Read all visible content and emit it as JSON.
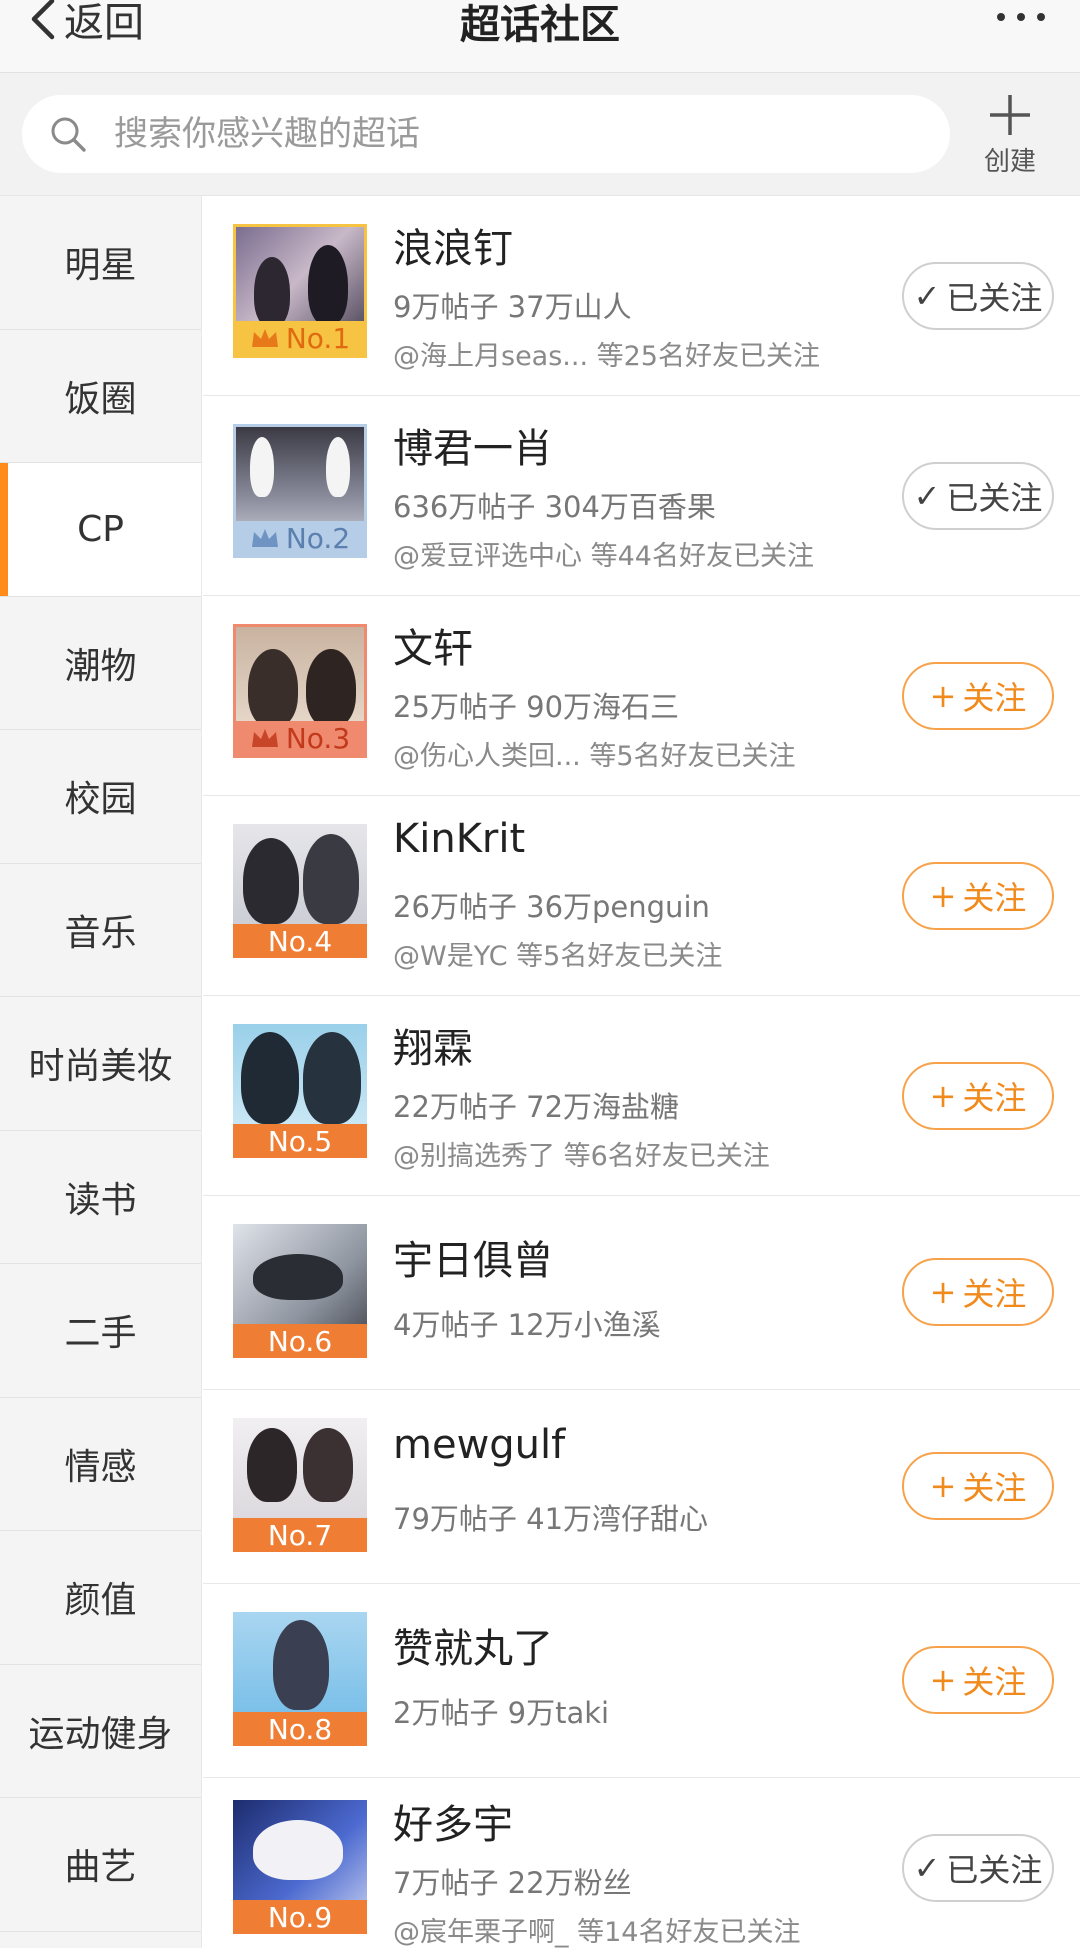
{
  "nav": {
    "back_label": "返回",
    "title": "超话社区"
  },
  "search": {
    "placeholder": "搜索你感兴趣的超话",
    "create_label": "创建"
  },
  "categories": [
    {
      "label": "明星"
    },
    {
      "label": "饭圈"
    },
    {
      "label": "CP"
    },
    {
      "label": "潮物"
    },
    {
      "label": "校园"
    },
    {
      "label": "音乐"
    },
    {
      "label": "时尚美妆"
    },
    {
      "label": "读书"
    },
    {
      "label": "二手"
    },
    {
      "label": "情感"
    },
    {
      "label": "颜值"
    },
    {
      "label": "运动健身"
    },
    {
      "label": "曲艺"
    }
  ],
  "active_category": "CP",
  "topics": [
    {
      "name": "浪浪钉",
      "stats": "9万帖子 37万山人",
      "friends": "@海上月seas... 等25名好友已关注",
      "rank": "No.1",
      "followed": true,
      "button": "已关注"
    },
    {
      "name": "博君一肖",
      "stats": "636万帖子 304万百香果",
      "friends": "@爱豆评选中心 等44名好友已关注",
      "rank": "No.2",
      "followed": true,
      "button": "已关注"
    },
    {
      "name": "文轩",
      "stats": "25万帖子 90万海石三",
      "friends": "@伤心人类回... 等5名好友已关注",
      "rank": "No.3",
      "followed": false,
      "button": "关注"
    },
    {
      "name": "KinKrit",
      "stats": "26万帖子 36万penguin",
      "friends": "@W是YC 等5名好友已关注",
      "rank": "No.4",
      "followed": false,
      "button": "关注"
    },
    {
      "name": "翔霖",
      "stats": "22万帖子 72万海盐糖",
      "friends": "@别搞选秀了 等6名好友已关注",
      "rank": "No.5",
      "followed": false,
      "button": "关注"
    },
    {
      "name": "宇日俱曾",
      "stats": "4万帖子 12万小渔溪",
      "friends": "",
      "rank": "No.6",
      "followed": false,
      "button": "关注"
    },
    {
      "name": "mewgulf",
      "stats": "79万帖子 41万湾仔甜心",
      "friends": "",
      "rank": "No.7",
      "followed": false,
      "button": "关注"
    },
    {
      "name": "赞就丸了",
      "stats": "2万帖子 9万taki",
      "friends": "",
      "rank": "No.8",
      "followed": false,
      "button": "关注"
    },
    {
      "name": "好多宇",
      "stats": "7万帖子 22万粉丝",
      "friends": "@宸年栗子啊_ 等14名好友已关注",
      "rank": "No.9",
      "followed": true,
      "button": "已关注"
    }
  ],
  "colors": {
    "accent": "#ff8c1a",
    "follow_border": "#f7a24a",
    "gold": "#f6c343",
    "silver": "#b5cde6",
    "bronze": "#f08a6e",
    "rank_orange": "#ef7d33"
  }
}
